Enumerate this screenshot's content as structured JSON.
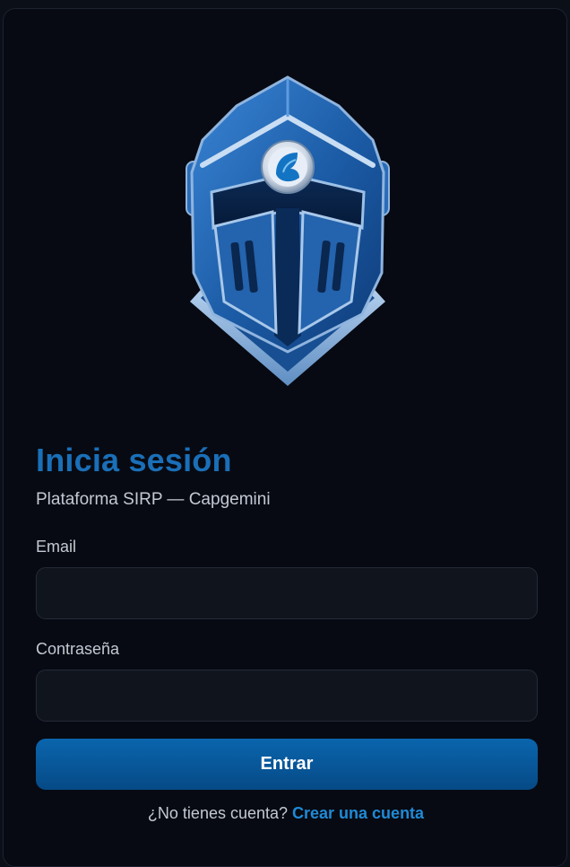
{
  "logo": {
    "icon": "knight-helmet-icon",
    "primary_color": "#1a5aa3"
  },
  "login": {
    "title": "Inicia sesión",
    "subtitle": "Plataforma SIRP — Capgemini",
    "email_label": "Email",
    "email_value": "",
    "password_label": "Contraseña",
    "password_value": "",
    "submit_label": "Entrar",
    "signup_prompt": "¿No tienes cuenta?",
    "signup_link": "Crear una cuenta"
  },
  "colors": {
    "background": "#070a12",
    "accent": "#1a6fb8",
    "button": "#0a65ad",
    "link": "#1f8ad6"
  }
}
